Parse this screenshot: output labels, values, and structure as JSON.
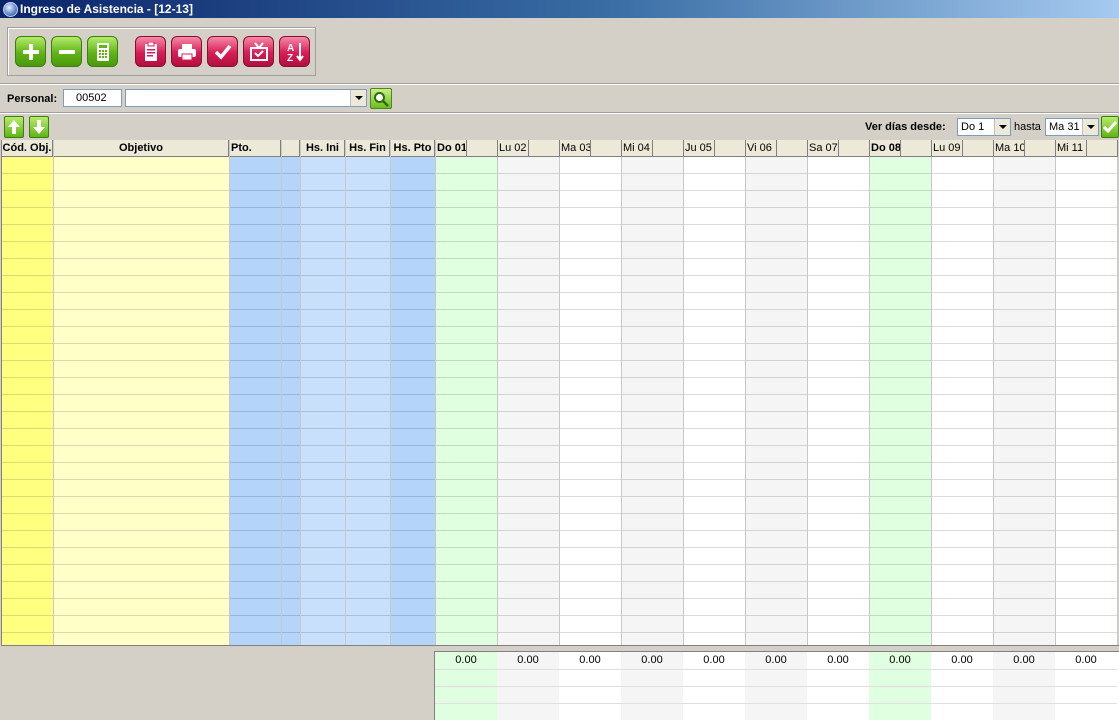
{
  "window": {
    "title": "Ingreso de Asistencia - [12-13]"
  },
  "toolbar": {
    "buttons": [
      {
        "name": "add-icon",
        "color": "#5fb416"
      },
      {
        "name": "remove-icon",
        "color": "#5fb416"
      },
      {
        "name": "calculator-icon",
        "color": "#5fb416"
      },
      {
        "name": "clipboard-icon",
        "color": "#d81c56"
      },
      {
        "name": "print-icon",
        "color": "#d81c56"
      },
      {
        "name": "check-icon",
        "color": "#d81c56"
      },
      {
        "name": "tv-icon",
        "color": "#d81c56"
      },
      {
        "name": "sort-az-icon",
        "color": "#d81c56"
      }
    ]
  },
  "personal": {
    "label": "Personal:",
    "code": "00502",
    "name": ""
  },
  "range": {
    "label": "Ver días desde:",
    "from": "Do 1",
    "to_label": "hasta",
    "to": "Ma 31"
  },
  "grid": {
    "columns": [
      {
        "label": "Cód. Obj.",
        "color": "#ffff80"
      },
      {
        "label": "Objetivo",
        "color": "#ffffc8"
      },
      {
        "label": "Pto.",
        "color": "#b4d4fa"
      },
      {
        "label": "",
        "color": "#b4d4fa"
      },
      {
        "label": "Hs. Ini",
        "color": "#c8e0fc"
      },
      {
        "label": "Hs. Fin",
        "color": "#c8e0fc"
      },
      {
        "label": "Hs. Pto",
        "color": "#b4d4fa"
      }
    ],
    "days": [
      {
        "label": "Do 01",
        "weekend": true
      },
      {
        "label": "Lu 02",
        "weekend": false
      },
      {
        "label": "Ma 03",
        "weekend": false
      },
      {
        "label": "Mi 04",
        "weekend": false
      },
      {
        "label": "Ju 05",
        "weekend": false
      },
      {
        "label": "Vi 06",
        "weekend": false
      },
      {
        "label": "Sa 07",
        "weekend": false
      },
      {
        "label": "Do 08",
        "weekend": true
      },
      {
        "label": "Lu 09",
        "weekend": false
      },
      {
        "label": "Ma 10",
        "weekend": false
      },
      {
        "label": "Mi 11",
        "weekend": false
      }
    ],
    "colors": {
      "sunday": "#e0ffe0",
      "alt": "#f5f5f5",
      "plain": "#ffffff"
    }
  },
  "totals": [
    "0.00",
    "0.00",
    "0.00",
    "0.00",
    "0.00",
    "0.00",
    "0.00",
    "0.00",
    "0.00",
    "0.00",
    "0.00"
  ]
}
